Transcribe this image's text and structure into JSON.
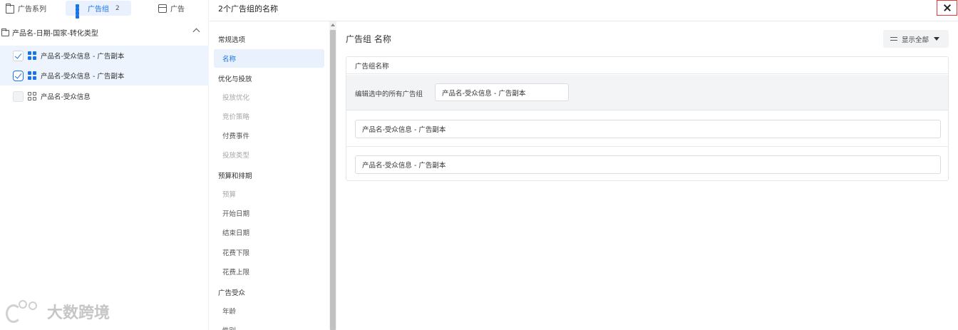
{
  "tabs": {
    "campaigns": "广告系列",
    "adsets": "广告组",
    "adsets_count": "2",
    "ads": "广告"
  },
  "tree": {
    "campaign": "产品名-日期-国家-转化类型",
    "adsets": [
      {
        "label": "产品名-受众信息 - 广告副本",
        "checked": true
      },
      {
        "label": "产品名-受众信息 - 广告副本",
        "checked": true
      },
      {
        "label": "产品名-受众信息",
        "checked": false
      }
    ]
  },
  "header": {
    "title": "2个广告组的名称"
  },
  "nav": {
    "sections": {
      "general": "常规选项",
      "optimization": "优化与投放",
      "budget": "预算和排期",
      "audience": "广告受众"
    },
    "items": {
      "name": "名称",
      "delivery_optimization": "投放优化",
      "bid_strategy": "竞价策略",
      "billing_event": "付费事件",
      "delivery_type": "投放类型",
      "budget": "预算",
      "start_date": "开始日期",
      "end_date": "结束日期",
      "spend_min": "花费下限",
      "spend_max": "花费上限",
      "age": "年龄",
      "gender": "性别"
    }
  },
  "content": {
    "title": "广告组 名称",
    "show_all": "显示全部",
    "card_header": "广告组名称",
    "bulk_label": "编辑选中的所有广告组",
    "bulk_value": "产品名-受众信息 - 广告副本",
    "names": [
      "产品名-受众信息 - 广告副本",
      "产品名-受众信息 - 广告副本"
    ]
  },
  "watermark": "大数跨境",
  "colors": {
    "accent": "#1a73e8",
    "selected_bg": "#edf4fe",
    "close_border": "#e53935"
  }
}
